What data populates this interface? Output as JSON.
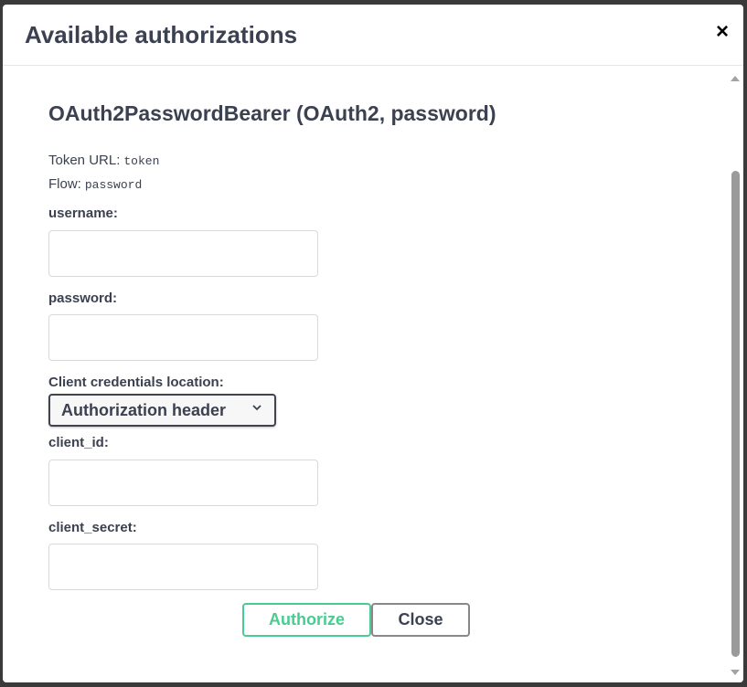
{
  "modal": {
    "title": "Available authorizations",
    "close_glyph": "×"
  },
  "scheme": {
    "title": "OAuth2PasswordBearer (OAuth2, password)",
    "token_url_label": "Token URL:",
    "token_url_value": "token",
    "flow_label": "Flow:",
    "flow_value": "password"
  },
  "fields": {
    "username_label": "username:",
    "username_value": "",
    "password_label": "password:",
    "password_value": "",
    "client_credentials_label": "Client credentials location:",
    "client_credentials_selected": "Authorization header",
    "client_id_label": "client_id:",
    "client_id_value": "",
    "client_secret_label": "client_secret:",
    "client_secret_value": ""
  },
  "buttons": {
    "authorize_label": "Authorize",
    "close_label": "Close"
  },
  "colors": {
    "authorize_accent": "#49cc90",
    "text": "#3b4151"
  },
  "icons": {
    "close": "close-icon",
    "select_chevron": "chevron-down-icon",
    "scroll_up": "scroll-up-arrow-icon",
    "scroll_down": "scroll-down-arrow-icon"
  }
}
